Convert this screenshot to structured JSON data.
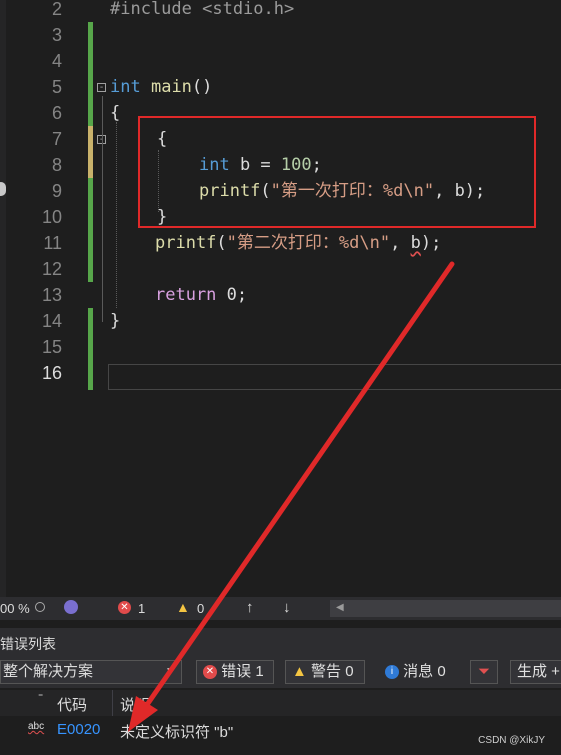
{
  "editor": {
    "lines": [
      "2",
      "3",
      "4",
      "5",
      "6",
      "7",
      "8",
      "9",
      "10",
      "11",
      "12",
      "13",
      "14",
      "15",
      "16"
    ],
    "include": "#include <stdio.h>",
    "kw_int": "int",
    "main_name": "main",
    "main_parens": "()",
    "open_brace": "{",
    "close_brace": "}",
    "decl_type": "int",
    "decl_rest": " b = ",
    "decl_num": "100",
    "decl_semi": ";",
    "printf_name": "printf",
    "printf1_open": "(",
    "printf1_str": "\"第一次打印：%d\\n\"",
    "printf1_rest": ", b);",
    "printf2_str": "\"第二次打印：%d\\n\"",
    "printf2_comma": ", ",
    "printf2_var": "b",
    "printf2_end": ");",
    "return_kw": "return",
    "return_rest": " 0;",
    "fold_minus": "-"
  },
  "status": {
    "zoom": "00 %",
    "errors": "1",
    "warnings": "0",
    "up": "↑",
    "down": "↓",
    "left": "◀"
  },
  "error_list": {
    "title": "错误列表",
    "scope": "整个解决方案",
    "errors_btn": "错误 1",
    "warnings_btn": "警告 0",
    "messages_btn": "消息 0",
    "build_btn": "生成 +",
    "col_code": "代码",
    "col_desc": "说明",
    "row": {
      "code": "E0020",
      "desc": "未定义标识符 \"b\"",
      "tag": "abc"
    }
  },
  "watermark": "CSDN @XikJY",
  "colors": {
    "accent_red": "#e02929",
    "green_bar": "#57a64a"
  }
}
